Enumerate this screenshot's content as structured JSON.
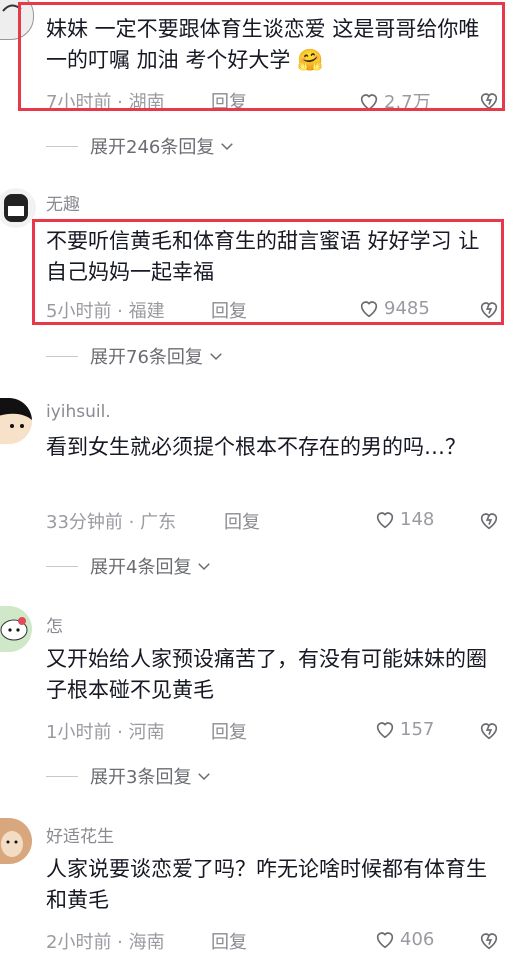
{
  "comments": [
    {
      "text": "妹妹 一定不要跟体育生谈恋爱 这是哥哥给你唯一的叮嘱 加油 考个好大学 🤗",
      "time": "7小时前 · 湖南",
      "reply": "回复",
      "likes": "2.7万",
      "expand": "展开246条回复"
    },
    {
      "username": "无趣",
      "text": "不要听信黄毛和体育生的甜言蜜语 好好学习 让自己妈妈一起幸福",
      "time": "5小时前 · 福建",
      "reply": "回复",
      "likes": "9485",
      "expand": "展开76条回复"
    },
    {
      "username": "iyihsuil.",
      "text": "看到女生就必须提个根本不存在的男的吗…？",
      "time": "33分钟前 · 广东",
      "reply": "回复",
      "likes": "148",
      "expand": "展开4条回复"
    },
    {
      "username": "怎",
      "text": "又开始给人家预设痛苦了，有没有可能妹妹的圈子根本碰不见黄毛",
      "time": "1小时前 · 河南",
      "reply": "回复",
      "likes": "157",
      "expand": "展开3条回复"
    },
    {
      "username": "好适花生",
      "text": "人家说要谈恋爱了吗？咋无论啥时候都有体育生和黄毛",
      "time": "2小时前 · 海南",
      "reply": "回复",
      "likes": "406"
    }
  ],
  "colors": {
    "highlight_border": "#e8384a",
    "meta_text": "#9a9ba1",
    "body_text": "#161823"
  },
  "icons": {
    "like": "heart-outline-icon",
    "dislike": "broken-heart-icon",
    "expand": "chevron-down-icon"
  }
}
